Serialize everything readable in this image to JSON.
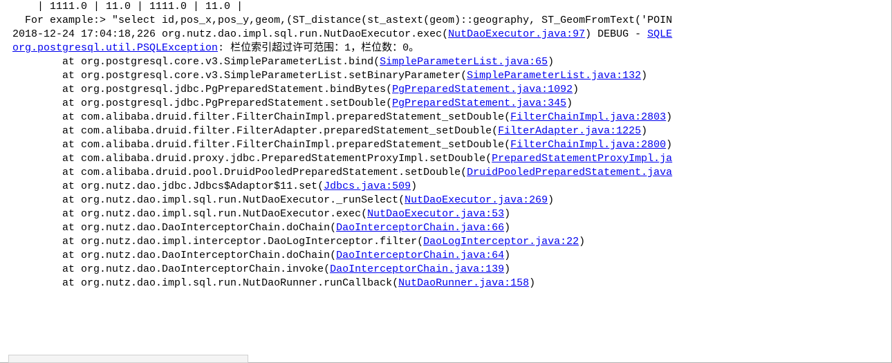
{
  "console": {
    "lines": [
      {
        "indent": "    ",
        "pre": "| 1111.0 | 11.0 | 1111.0 | 11.0 |"
      },
      {
        "indent": "  ",
        "pre": "For example:> \"select id,pos_x,pos_y,geom,(ST_distance(st_astext(geom)::geography, ST_GeomFromText('POIN"
      },
      {
        "indent": "",
        "pre": "2018-12-24 17:04:18,226 org.nutz.dao.impl.sql.run.NutDaoExecutor.exec(",
        "link": "NutDaoExecutor.java:97",
        "post": ") DEBUG - ",
        "tail_link": "SQLE"
      },
      {
        "indent": "",
        "link": "org.postgresql.util.PSQLException",
        "post": ": 栏位索引超过许可范围：1，栏位数：0。"
      },
      {
        "indent": "        ",
        "pre": "at org.postgresql.core.v3.SimpleParameterList.bind(",
        "link": "SimpleParameterList.java:65",
        "post": ")"
      },
      {
        "indent": "        ",
        "pre": "at org.postgresql.core.v3.SimpleParameterList.setBinaryParameter(",
        "link": "SimpleParameterList.java:132",
        "post": ")"
      },
      {
        "indent": "        ",
        "pre": "at org.postgresql.jdbc.PgPreparedStatement.bindBytes(",
        "link": "PgPreparedStatement.java:1092",
        "post": ")"
      },
      {
        "indent": "        ",
        "pre": "at org.postgresql.jdbc.PgPreparedStatement.setDouble(",
        "link": "PgPreparedStatement.java:345",
        "post": ")"
      },
      {
        "indent": "        ",
        "pre": "at com.alibaba.druid.filter.FilterChainImpl.preparedStatement_setDouble(",
        "link": "FilterChainImpl.java:2803",
        "post": ")"
      },
      {
        "indent": "        ",
        "pre": "at com.alibaba.druid.filter.FilterAdapter.preparedStatement_setDouble(",
        "link": "FilterAdapter.java:1225",
        "post": ")"
      },
      {
        "indent": "        ",
        "pre": "at com.alibaba.druid.filter.FilterChainImpl.preparedStatement_setDouble(",
        "link": "FilterChainImpl.java:2800",
        "post": ")"
      },
      {
        "indent": "        ",
        "pre": "at com.alibaba.druid.proxy.jdbc.PreparedStatementProxyImpl.setDouble(",
        "link": "PreparedStatementProxyImpl.ja",
        "post": ""
      },
      {
        "indent": "        ",
        "pre": "at com.alibaba.druid.pool.DruidPooledPreparedStatement.setDouble(",
        "link": "DruidPooledPreparedStatement.java",
        "post": ""
      },
      {
        "indent": "        ",
        "pre": "at org.nutz.dao.jdbc.Jdbcs$Adaptor$11.set(",
        "link": "Jdbcs.java:509",
        "post": ")"
      },
      {
        "indent": "        ",
        "pre": "at org.nutz.dao.impl.sql.run.NutDaoExecutor._runSelect(",
        "link": "NutDaoExecutor.java:269",
        "post": ")"
      },
      {
        "indent": "        ",
        "pre": "at org.nutz.dao.impl.sql.run.NutDaoExecutor.exec(",
        "link": "NutDaoExecutor.java:53",
        "post": ")"
      },
      {
        "indent": "        ",
        "pre": "at org.nutz.dao.DaoInterceptorChain.doChain(",
        "link": "DaoInterceptorChain.java:66",
        "post": ")"
      },
      {
        "indent": "        ",
        "pre": "at org.nutz.dao.impl.interceptor.DaoLogInterceptor.filter(",
        "link": "DaoLogInterceptor.java:22",
        "post": ")"
      },
      {
        "indent": "        ",
        "pre": "at org.nutz.dao.DaoInterceptorChain.doChain(",
        "link": "DaoInterceptorChain.java:64",
        "post": ")"
      },
      {
        "indent": "        ",
        "pre": "at org.nutz.dao.DaoInterceptorChain.invoke(",
        "link": "DaoInterceptorChain.java:139",
        "post": ")"
      },
      {
        "indent": "        ",
        "pre": "at org.nutz.dao.impl.sql.run.NutDaoRunner.runCallback(",
        "link": "NutDaoRunner.java:158",
        "post": ")"
      }
    ]
  }
}
